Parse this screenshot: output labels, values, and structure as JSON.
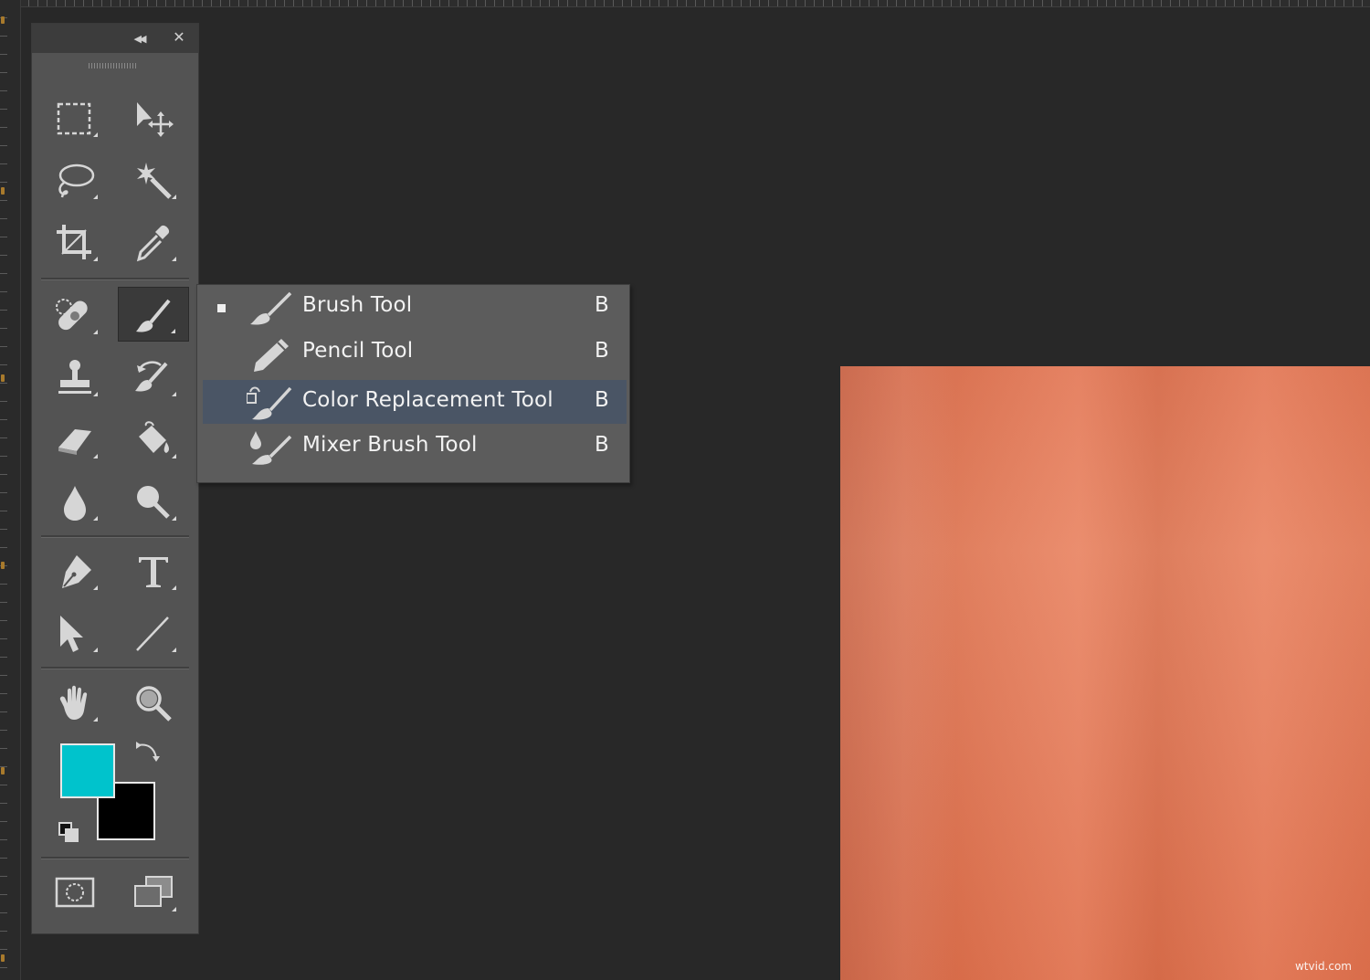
{
  "panel": {
    "collapse_glyph": "◀◀",
    "close_glyph": "✕"
  },
  "tools": [
    {
      "id": "marquee",
      "icon": "rectangular-marquee-icon"
    },
    {
      "id": "move",
      "icon": "move-tool-icon"
    },
    {
      "id": "lasso",
      "icon": "lasso-icon"
    },
    {
      "id": "magic-wand",
      "icon": "magic-wand-icon"
    },
    {
      "id": "crop",
      "icon": "crop-icon"
    },
    {
      "id": "eyedropper",
      "icon": "eyedropper-icon"
    },
    {
      "id": "healing",
      "icon": "spot-healing-icon"
    },
    {
      "id": "brush",
      "icon": "brush-icon",
      "active": true
    },
    {
      "id": "stamp",
      "icon": "clone-stamp-icon"
    },
    {
      "id": "history-brush",
      "icon": "history-brush-icon"
    },
    {
      "id": "eraser",
      "icon": "eraser-icon"
    },
    {
      "id": "paint-bucket",
      "icon": "paint-bucket-icon"
    },
    {
      "id": "blur",
      "icon": "blur-drop-icon"
    },
    {
      "id": "dodge",
      "icon": "dodge-icon"
    },
    {
      "id": "pen",
      "icon": "pen-icon"
    },
    {
      "id": "type",
      "icon": "type-icon"
    },
    {
      "id": "path-select",
      "icon": "path-selection-icon"
    },
    {
      "id": "line",
      "icon": "line-icon"
    },
    {
      "id": "hand",
      "icon": "hand-icon"
    },
    {
      "id": "zoom",
      "icon": "zoom-icon"
    }
  ],
  "colors": {
    "foreground": "#00c3cc",
    "background": "#000000"
  },
  "flyout": {
    "items": [
      {
        "label": "Brush Tool",
        "key": "B",
        "icon": "brush-icon",
        "selected": true
      },
      {
        "label": "Pencil Tool",
        "key": "B",
        "icon": "pencil-icon"
      },
      {
        "label": "Color Replacement Tool",
        "key": "B",
        "icon": "color-replacement-icon",
        "hover": true
      },
      {
        "label": "Mixer Brush Tool",
        "key": "B",
        "icon": "mixer-brush-icon"
      }
    ]
  },
  "watermark": "wtvid.com"
}
